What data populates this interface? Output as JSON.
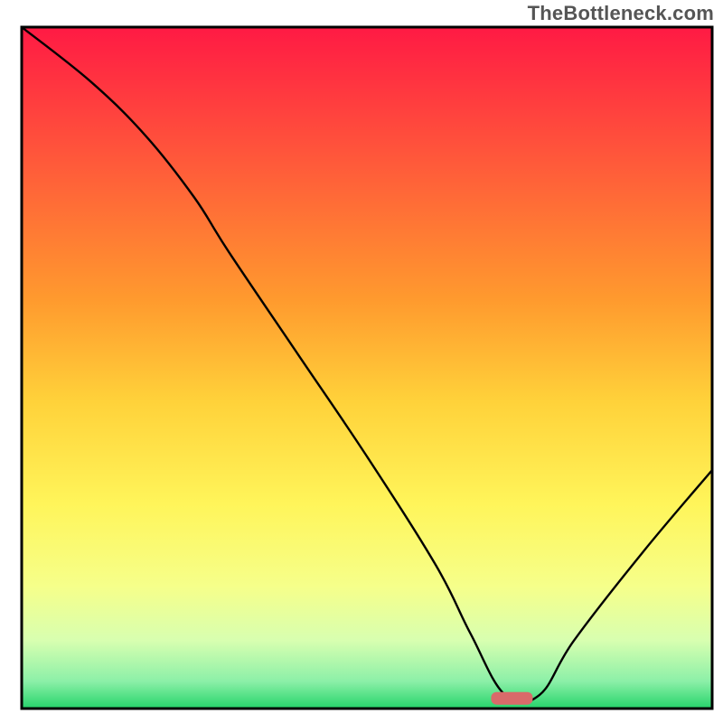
{
  "watermark": "TheBottleneck.com",
  "chart_data": {
    "type": "line",
    "title": "",
    "xlabel": "",
    "ylabel": "",
    "xlim": [
      0,
      100
    ],
    "ylim": [
      0,
      100
    ],
    "grid": false,
    "description": "Bottleneck curve over a vertical red-to-green gradient field. Y axis is bottleneck percentage (high=red=bad, low=green=good). A single black curve descends from top-left, reaches a minimum near x≈70, then rises again. A small red marker pill sits at the valley bottom.",
    "series": [
      {
        "name": "bottleneck-curve",
        "x": [
          0,
          10,
          18,
          25,
          30,
          40,
          50,
          60,
          65,
          70,
          75,
          80,
          90,
          100
        ],
        "values": [
          100,
          92,
          84,
          75,
          67,
          52,
          37,
          21,
          11,
          2,
          2,
          10,
          23,
          35
        ]
      }
    ],
    "marker": {
      "x": 71,
      "y": 1.5,
      "color": "#d96a6a"
    },
    "gradient_stops": [
      {
        "offset": 0.0,
        "color": "#ff1a44"
      },
      {
        "offset": 0.2,
        "color": "#ff5a3a"
      },
      {
        "offset": 0.4,
        "color": "#ff9a2e"
      },
      {
        "offset": 0.55,
        "color": "#ffd23a"
      },
      {
        "offset": 0.7,
        "color": "#fff55a"
      },
      {
        "offset": 0.82,
        "color": "#f6ff8a"
      },
      {
        "offset": 0.9,
        "color": "#d8ffb0"
      },
      {
        "offset": 0.96,
        "color": "#8cf0a8"
      },
      {
        "offset": 1.0,
        "color": "#25d36b"
      }
    ],
    "frame_color": "#000000"
  }
}
